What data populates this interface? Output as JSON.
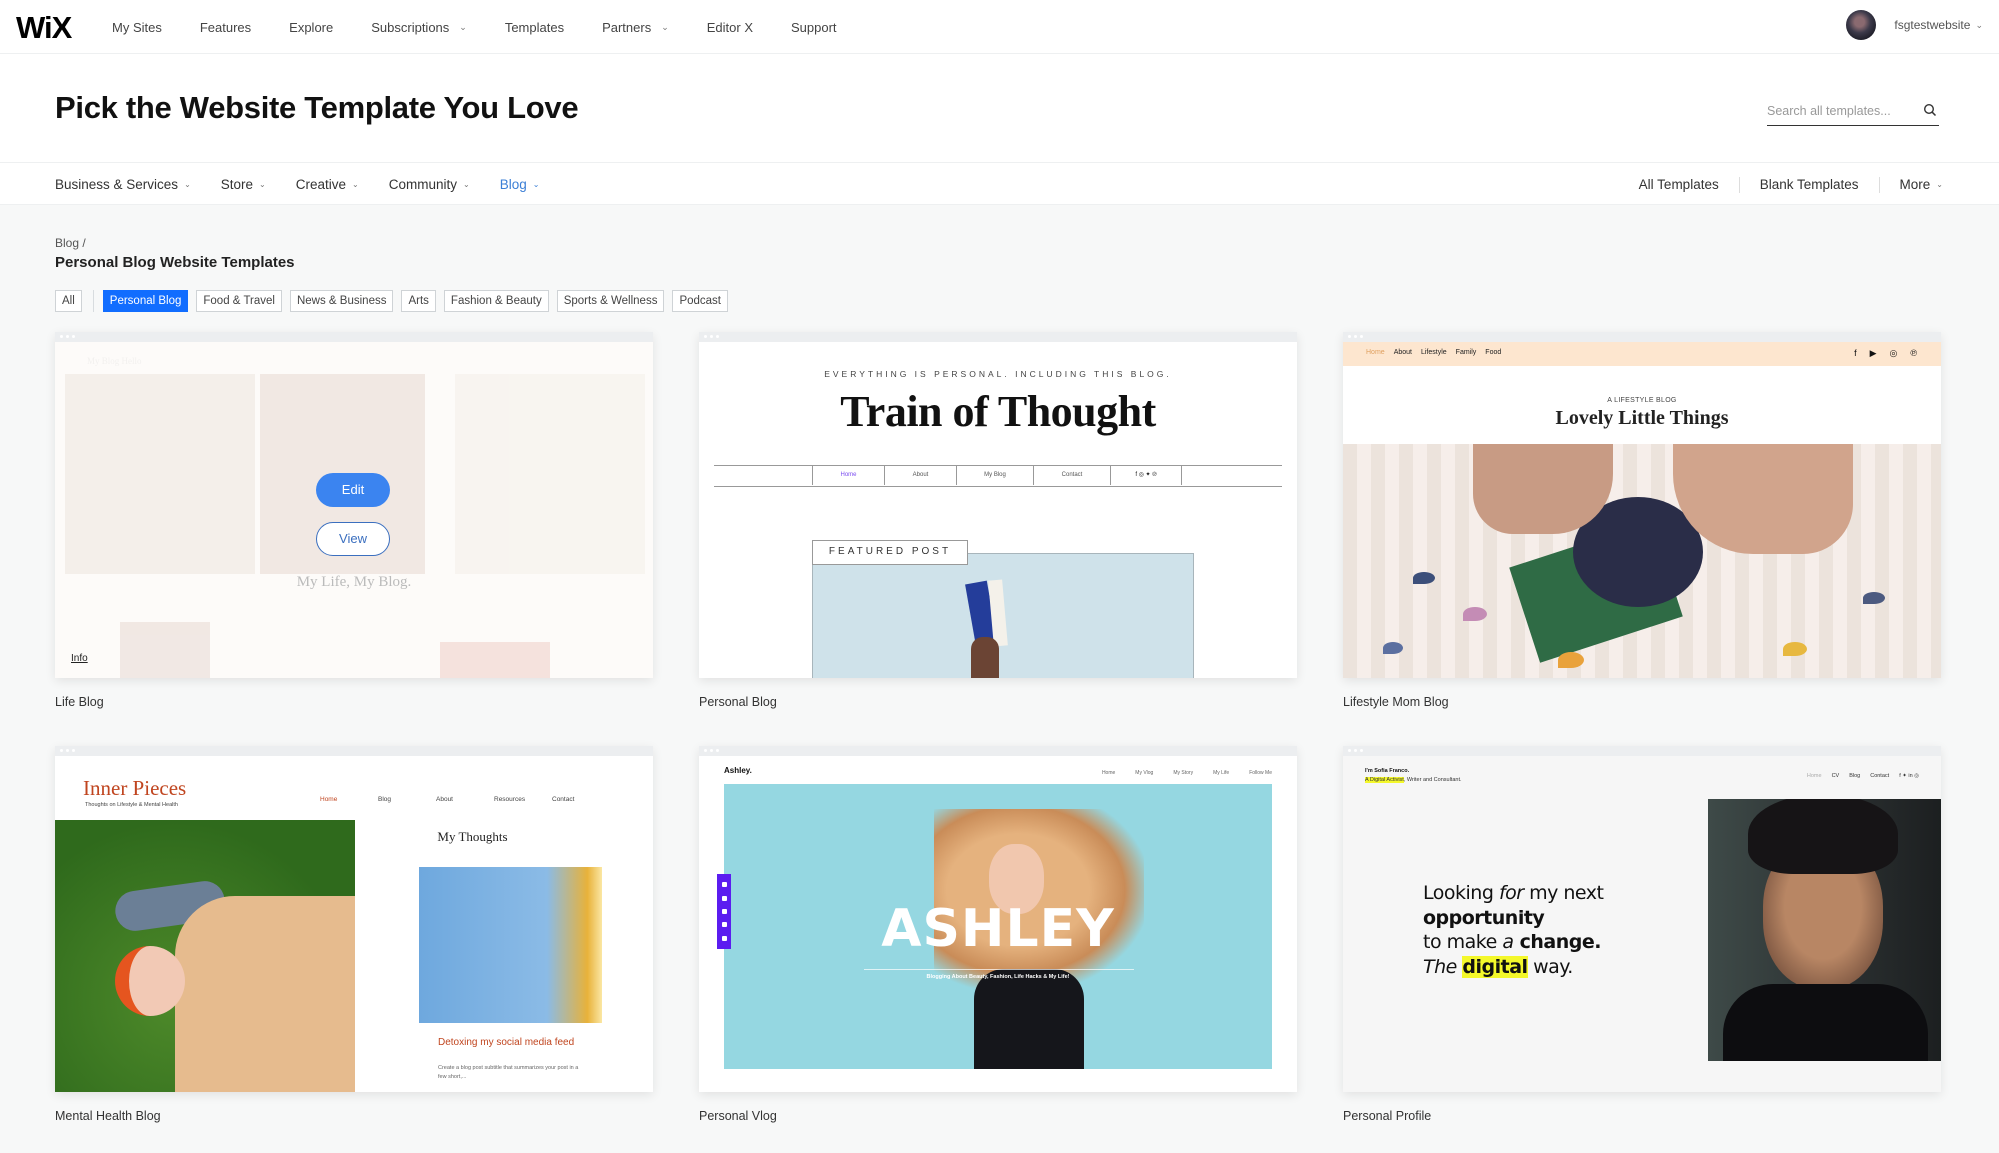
{
  "topnav": {
    "logo": "WiX",
    "items": [
      {
        "label": "My Sites",
        "has_dropdown": false
      },
      {
        "label": "Features",
        "has_dropdown": false
      },
      {
        "label": "Explore",
        "has_dropdown": false
      },
      {
        "label": "Subscriptions",
        "has_dropdown": true
      },
      {
        "label": "Templates",
        "has_dropdown": false
      },
      {
        "label": "Partners",
        "has_dropdown": true
      },
      {
        "label": "Editor X",
        "has_dropdown": false
      },
      {
        "label": "Support",
        "has_dropdown": false
      }
    ],
    "username": "fsgtestwebsite",
    "chevron": "⌄"
  },
  "header": {
    "title": "Pick the Website Template You Love",
    "search_placeholder": "Search all templates...",
    "search_value": ""
  },
  "categories": {
    "left": [
      {
        "label": "Business & Services",
        "active": false
      },
      {
        "label": "Store",
        "active": false
      },
      {
        "label": "Creative",
        "active": false
      },
      {
        "label": "Community",
        "active": false
      },
      {
        "label": "Blog",
        "active": true
      }
    ],
    "right": [
      {
        "label": "All Templates"
      },
      {
        "label": "Blank Templates"
      },
      {
        "label": "More"
      }
    ],
    "chevron": "⌄"
  },
  "breadcrumb": "Blog /",
  "section_title": "Personal Blog Website Templates",
  "filters": {
    "all": "All",
    "chips": [
      {
        "label": "Personal Blog",
        "active": true
      },
      {
        "label": "Food & Travel",
        "active": false
      },
      {
        "label": "News & Business",
        "active": false
      },
      {
        "label": "Arts",
        "active": false
      },
      {
        "label": "Fashion & Beauty",
        "active": false
      },
      {
        "label": "Sports & Wellness",
        "active": false
      },
      {
        "label": "Podcast",
        "active": false
      }
    ]
  },
  "templates": [
    {
      "name": "Life Blog",
      "hover": true,
      "edit_label": "Edit",
      "view_label": "View",
      "info_label": "Info",
      "preview": {
        "site_title": "My Life, My Blog."
      }
    },
    {
      "name": "Personal Blog",
      "preview": {
        "tagline": "EVERYTHING IS PERSONAL. INCLUDING THIS BLOG.",
        "title": "Train of Thought",
        "menu": [
          "Home",
          "About",
          "My Blog",
          "Contact",
          "f ◎ ✦ ℗"
        ],
        "featured": "FEATURED POST"
      }
    },
    {
      "name": "Lifestyle Mom Blog",
      "preview": {
        "menu": [
          "Home",
          "About",
          "Lifestyle",
          "Family",
          "Food"
        ],
        "social": [
          "f",
          "▶",
          "◎",
          "℗"
        ],
        "kicker": "A LIFESTYLE BLOG",
        "title": "Lovely Little Things"
      }
    },
    {
      "name": "Mental Health Blog",
      "preview": {
        "brand": "Inner Pieces",
        "subtitle": "Thoughts on Lifestyle & Mental Health",
        "menu": [
          "Home",
          "Blog",
          "About",
          "Resources",
          "Contact"
        ],
        "section": "My Thoughts",
        "post_title": "Detoxing my social media feed",
        "post_summary": "Create a blog post subtitle that summarizes your post in a few short,..."
      }
    },
    {
      "name": "Personal Vlog",
      "preview": {
        "brand": "Ashley.",
        "menu": [
          "Home",
          "My Vlog",
          "My Story",
          "My Life",
          "Follow Me"
        ],
        "hero_name": "ASHLEY",
        "hero_tagline": "Blogging About Beauty, Fashion, Life Hacks & My Life!"
      }
    },
    {
      "name": "Personal Profile",
      "preview": {
        "name": "I'm Sofia Franco.",
        "role_highlight": "A Digital Activist",
        "role_rest": ", Writer and Consultant.",
        "menu": [
          "Home",
          "CV",
          "Blog",
          "Contact",
          "f ✦ in ◎"
        ],
        "headline": {
          "l1a": "Looking ",
          "l1b": "for",
          "l1c": " my next",
          "l2": "opportunity",
          "l3a": "to make ",
          "l3b": "a",
          "l3c": " change.",
          "l4a": "The ",
          "l4b": "digital",
          "l4c": " way."
        }
      }
    }
  ],
  "colors": {
    "accent": "#116dff",
    "active_category": "#3b7fd6",
    "edit_button": "#3b84f0",
    "page_bg": "#f7f8f8"
  }
}
